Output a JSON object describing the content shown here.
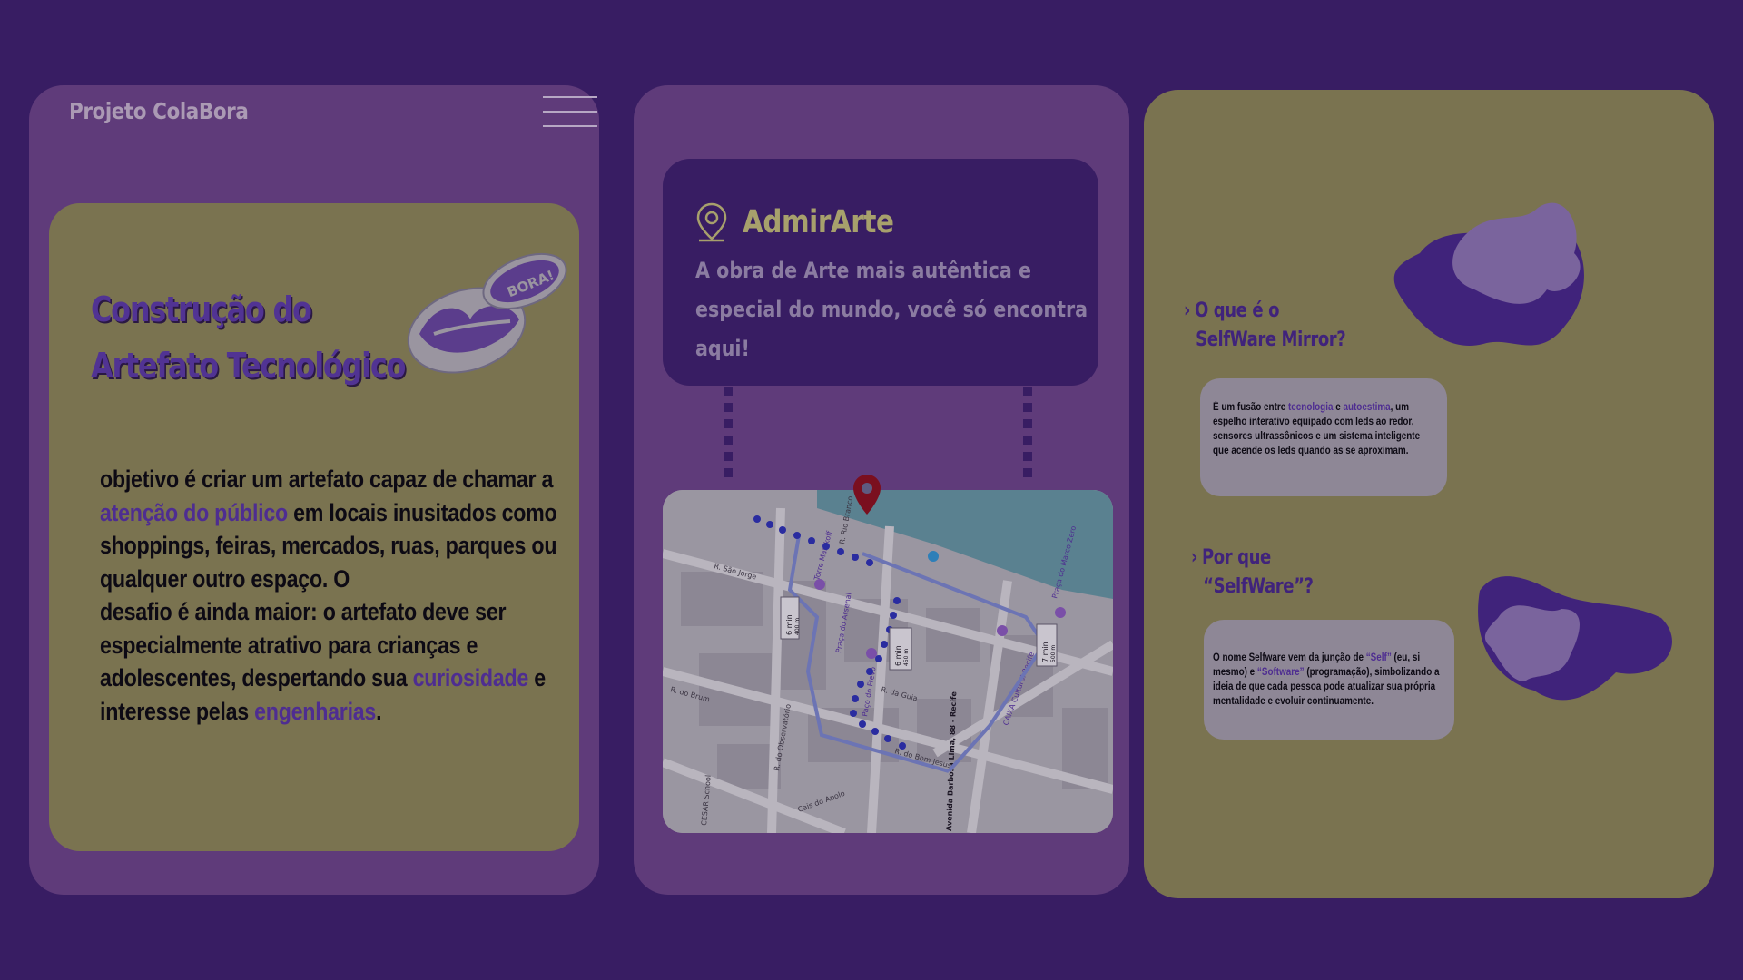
{
  "header": {
    "brand": "Projeto ColaBora",
    "menu_icon": "hamburger-menu-icon"
  },
  "artifact_card": {
    "title_line1": "Construção do",
    "title_line2": "Artefato Tecnológico",
    "badge": "BORA!",
    "text_1": "objetivo é criar um artefato capaz de chamar a ",
    "highlight_1": "atenção do público",
    "text_2": " em locais inusitados como shoppings, feiras, mercados, ruas, parques ou qualquer outro espaço. O",
    "text_3": "desafio é ainda maior: o artefato deve ser especialmente atrativo para crianças e adolescentes, despertando sua ",
    "highlight_2": "curiosidade",
    "text_4": " e interesse pelas ",
    "highlight_3": "engenharias",
    "text_5": "."
  },
  "location_card": {
    "title": "AdmirArte",
    "text": " A obra de Arte mais autêntica e especial do mundo, você só encontra aqui!",
    "pin_icon": "location-pin-icon"
  },
  "map": {
    "streets": [
      "R. do Bom Jesus",
      "R. do Observatório",
      "R. da Guia",
      "R. São Jorge",
      "R. do Brum",
      "Cais do Apolo",
      "R. Rio Branco"
    ],
    "places": [
      "Torre Malakoff",
      "Praça do Arsenal",
      "CAIXA Cultural Recife",
      "Paço do Frevo",
      "Praça do Marco Zero",
      "CESAR School"
    ],
    "route_times": [
      "6 min",
      "6 min",
      "7 min"
    ],
    "route_distances": [
      "400 m",
      "450 m",
      "500 m"
    ],
    "address": "Avenida Barbosa Lima, 88 - Recife"
  },
  "faq": [
    {
      "question_line1": "O que é o",
      "question_line2": "SelfWare Mirror?",
      "answer_1": "É um fusão entre ",
      "answer_hl1": "tecnologia",
      "answer_2": " e ",
      "answer_hl2": "autoestima",
      "answer_3": ", um espelho interativo equipado com leds ao redor, sensores ultrassônicos e um sistema inteligente que acende os leds quando as se aproximam."
    },
    {
      "question_line1": "Por que",
      "question_line2": "“SelfWare”?",
      "answer_1": "O nome Selfware vem da junção de ",
      "answer_hl1": "“Self”",
      "answer_2": " (eu, si mesmo) e ",
      "answer_hl2": "“Software”",
      "answer_3": " (programação), simbolizando a ideia de que cada pessoa pode atualizar sua própria mentalidade e evoluir continuamente."
    }
  ],
  "colors": {
    "background": "#381D63",
    "panel_purple": "#5F3B7A",
    "panel_olive": "#7A7350",
    "accent_purple": "#4E2D91",
    "title_gold": "#A7A06C"
  }
}
